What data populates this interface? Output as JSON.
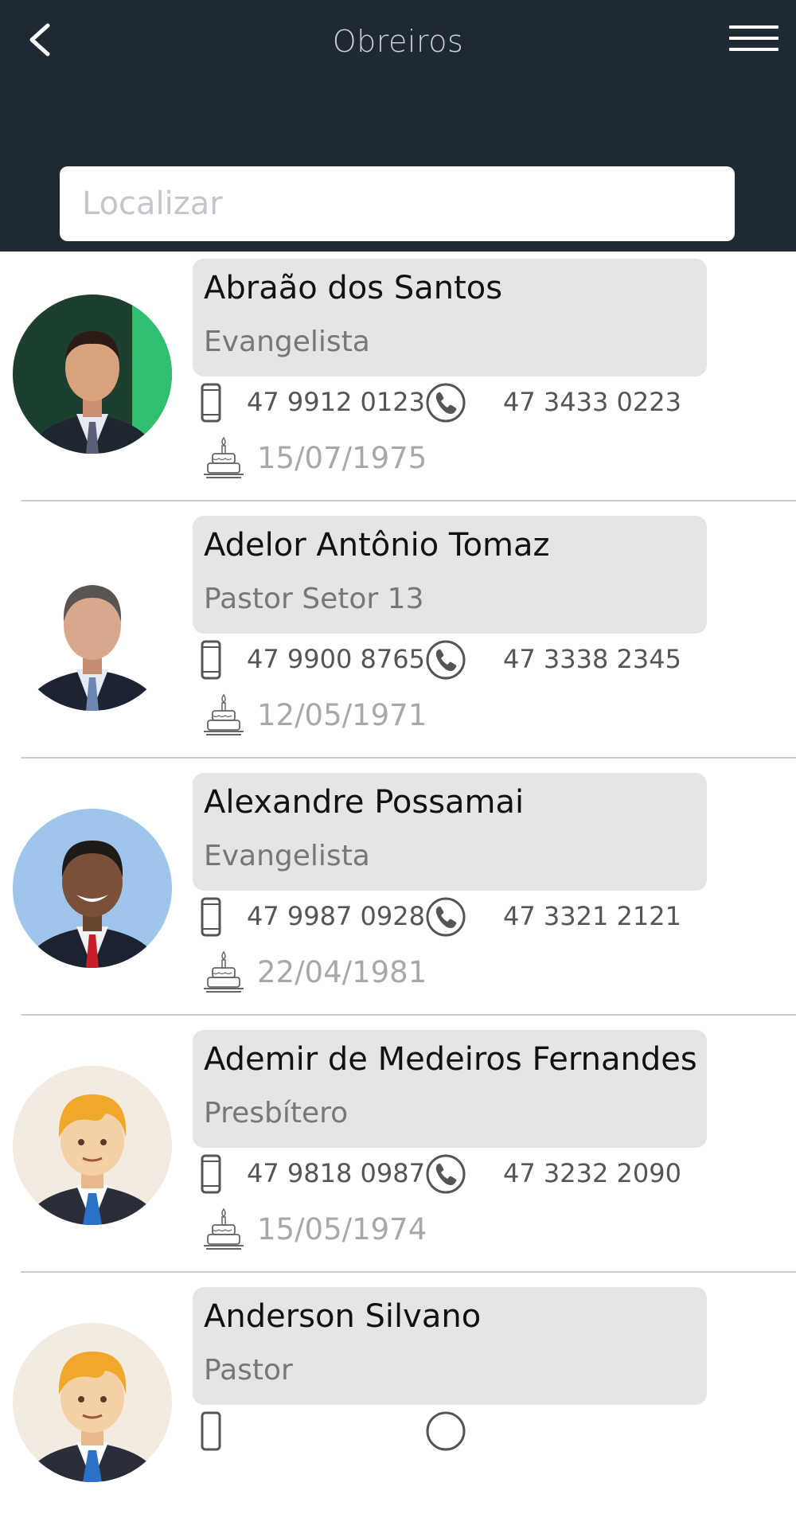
{
  "header": {
    "title": "Obreiros",
    "background_color": "#1f2933",
    "back_icon": "chevron-left-icon",
    "menu_icon": "hamburger-menu-icon"
  },
  "search": {
    "placeholder": "Localizar"
  },
  "workers": [
    {
      "name": "Abraão dos Santos",
      "role": "Evangelista",
      "mobile": "47 9912 0123",
      "phone": "47 3433 0223",
      "birthday": "15/07/1975"
    },
    {
      "name": "Adelor Antônio Tomaz",
      "role": "Pastor Setor 13",
      "mobile": "47 9900 8765",
      "phone": "47 3338 2345",
      "birthday": "12/05/1971"
    },
    {
      "name": "Alexandre Possamai",
      "role": "Evangelista",
      "mobile": "47 9987 0928",
      "phone": "47 3321 2121",
      "birthday": "22/04/1981"
    },
    {
      "name": "Ademir de Medeiros Fernandes",
      "role": "Presbítero",
      "mobile": "47 9818 0987",
      "phone": "47 3232 2090",
      "birthday": "15/05/1974"
    },
    {
      "name": "Anderson Silvano",
      "role": "Pastor",
      "mobile": "",
      "phone": "",
      "birthday": ""
    }
  ]
}
